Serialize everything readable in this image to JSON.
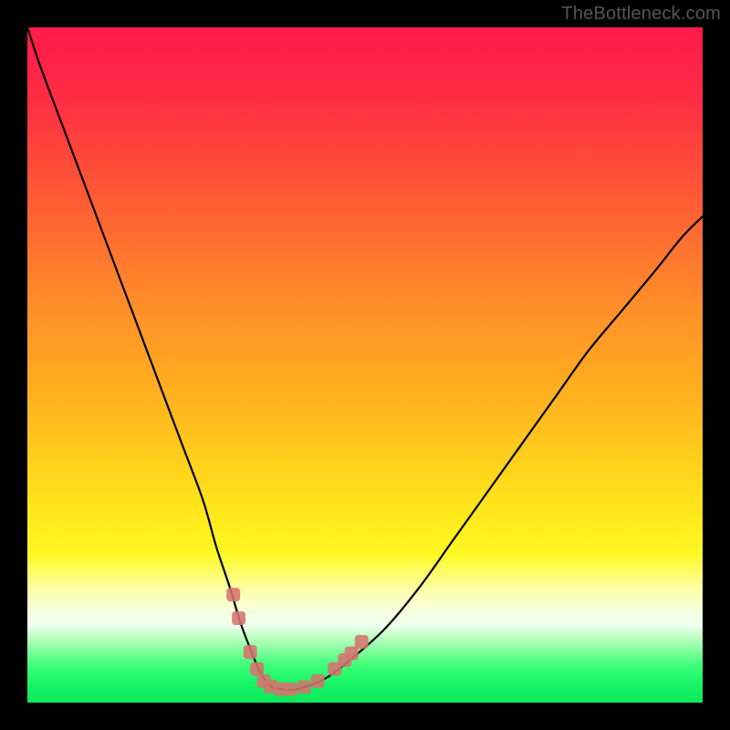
{
  "watermark": "TheBottleneck.com",
  "gradient_stops": [
    {
      "offset": 0.0,
      "color": "#ff1a4b"
    },
    {
      "offset": 0.1,
      "color": "#ff2b44"
    },
    {
      "offset": 0.25,
      "color": "#ff5a34"
    },
    {
      "offset": 0.4,
      "color": "#ff8a2a"
    },
    {
      "offset": 0.55,
      "color": "#ffb31f"
    },
    {
      "offset": 0.7,
      "color": "#ffe21a"
    },
    {
      "offset": 0.78,
      "color": "#fff923"
    },
    {
      "offset": 0.83,
      "color": "#fdffa3"
    },
    {
      "offset": 0.86,
      "color": "#f8ffd8"
    },
    {
      "offset": 0.885,
      "color": "#eefff0"
    },
    {
      "offset": 0.905,
      "color": "#b8ffbf"
    },
    {
      "offset": 0.925,
      "color": "#7bff98"
    },
    {
      "offset": 0.945,
      "color": "#3eff79"
    },
    {
      "offset": 0.97,
      "color": "#18f566"
    },
    {
      "offset": 1.0,
      "color": "#0be85a"
    }
  ],
  "chart_data": {
    "type": "line",
    "title": "",
    "xlabel": "",
    "ylabel": "",
    "xlim": [
      0,
      100
    ],
    "ylim": [
      0,
      100
    ],
    "series": [
      {
        "name": "bottleneck-curve",
        "x": [
          0,
          2,
          5,
          8,
          11,
          14,
          17,
          20,
          23,
          26,
          28,
          30,
          31.5,
          33,
          34.5,
          36,
          37.5,
          40,
          44,
          48,
          53,
          58,
          63,
          68,
          73,
          78,
          83,
          88,
          93,
          97,
          100
        ],
        "y": [
          100,
          94,
          86,
          78,
          70,
          62,
          54,
          46,
          38,
          30,
          23,
          17,
          12,
          8,
          4.5,
          2.5,
          2,
          2,
          3.5,
          6.5,
          11,
          17,
          24,
          31,
          38,
          45,
          52,
          58,
          64,
          69,
          72
        ]
      }
    ],
    "markers": {
      "name": "highlight-points",
      "color": "#d5746e",
      "shape": "rounded-square",
      "points": [
        {
          "x": 30.5,
          "y": 16
        },
        {
          "x": 31.3,
          "y": 12.5
        },
        {
          "x": 33.0,
          "y": 7.5
        },
        {
          "x": 34.0,
          "y": 5.0
        },
        {
          "x": 35.0,
          "y": 3.2
        },
        {
          "x": 36.0,
          "y": 2.4
        },
        {
          "x": 37.5,
          "y": 2.0
        },
        {
          "x": 39.0,
          "y": 2.0
        },
        {
          "x": 41.0,
          "y": 2.3
        },
        {
          "x": 43.0,
          "y": 3.2
        },
        {
          "x": 45.5,
          "y": 5.0
        },
        {
          "x": 47.0,
          "y": 6.3
        },
        {
          "x": 48.0,
          "y": 7.3
        },
        {
          "x": 49.5,
          "y": 9.0
        }
      ]
    }
  }
}
